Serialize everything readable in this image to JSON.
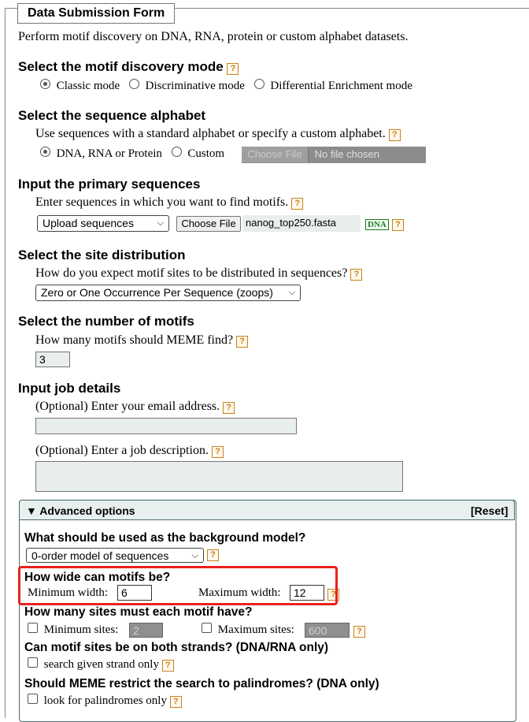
{
  "form": {
    "legend": "Data Submission Form",
    "intro": "Perform motif discovery on DNA, RNA, protein or custom alphabet datasets."
  },
  "help_glyph": "?",
  "mode": {
    "heading": "Select the motif discovery mode",
    "options": [
      "Classic mode",
      "Discriminative mode",
      "Differential Enrichment mode"
    ],
    "selected": "Classic mode"
  },
  "alphabet": {
    "heading": "Select the sequence alphabet",
    "desc": "Use sequences with a standard alphabet or specify a custom alphabet.",
    "option_standard": "DNA, RNA or Protein",
    "option_custom": "Custom",
    "selected": "DNA, RNA or Protein",
    "file_button": "Choose File",
    "file_status": "No file chosen"
  },
  "primary": {
    "heading": "Input the primary sequences",
    "desc": "Enter sequences in which you want to find motifs.",
    "source_select": "Upload sequences",
    "file_button": "Choose File",
    "file_name": "nanog_top250.fasta",
    "alphabet_badge": "DNA"
  },
  "distribution": {
    "heading": "Select the site distribution",
    "desc": "How do you expect motif sites to be distributed in sequences?",
    "select": "Zero or One Occurrence Per Sequence (zoops)"
  },
  "nmotifs": {
    "heading": "Select the number of motifs",
    "desc": "How many motifs should MEME find?",
    "value": "3"
  },
  "job": {
    "heading": "Input job details",
    "email_label": "(Optional) Enter your email address.",
    "email_value": "",
    "desc_label": "(Optional) Enter a job description.",
    "desc_value": ""
  },
  "advanced": {
    "toggle": "▼ Advanced options",
    "reset": "[Reset]",
    "background_heading": "What should be used as the background model?",
    "background_select": "0-order model of sequences",
    "width_heading": "How wide can motifs be?",
    "min_width_label": "Minimum width:",
    "min_width": "6",
    "max_width_label": "Maximum width:",
    "max_width": "12",
    "sites_heading": "How many sites must each motif have?",
    "min_sites_label": "Minimum sites:",
    "min_sites": "2",
    "max_sites_label": "Maximum sites:",
    "max_sites": "600",
    "strands_heading": "Can motif sites be on both strands? (DNA/RNA only)",
    "strands_option": "search given strand only",
    "pal_heading": "Should MEME restrict the search to palindromes? (DNA only)",
    "pal_option": "look for palindromes only"
  },
  "colors": {
    "highlight": "#e8231c",
    "help": "#c8821b",
    "dna_badge": "#1a7a1a"
  }
}
